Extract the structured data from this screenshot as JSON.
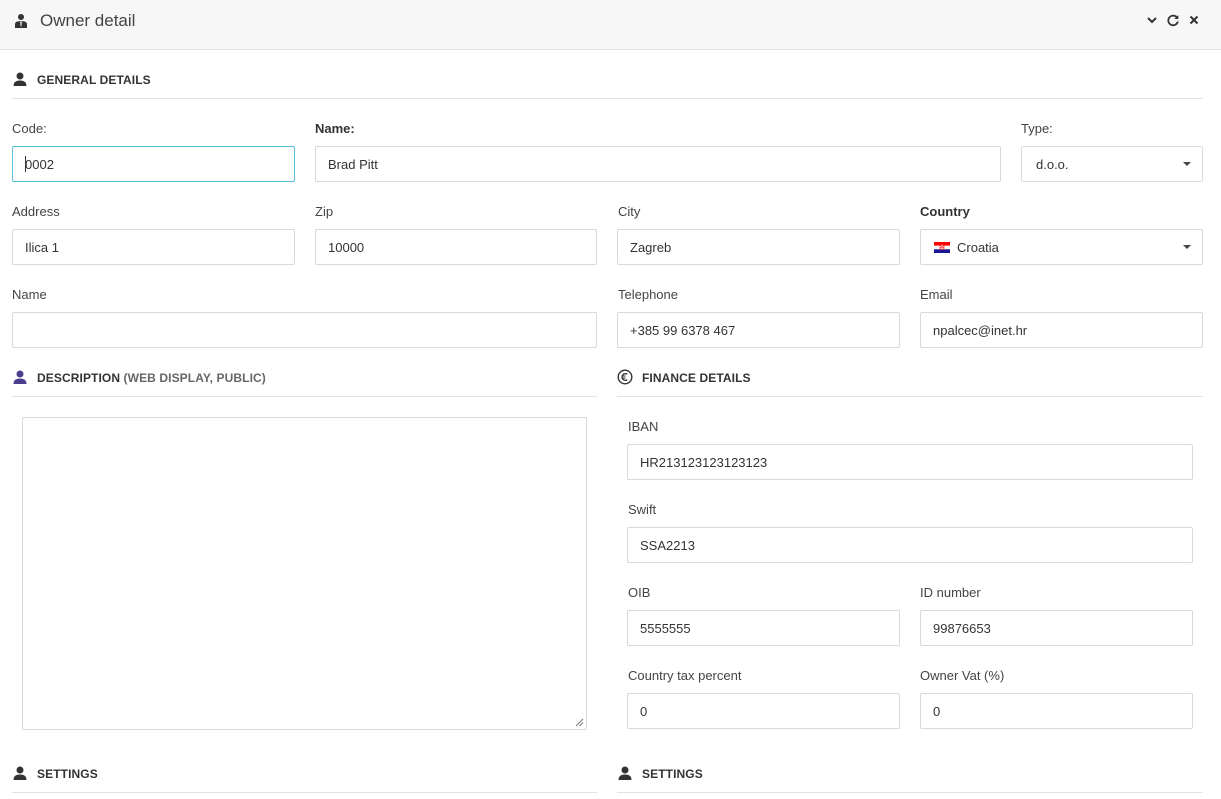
{
  "window": {
    "title": "Owner detail",
    "icons": {
      "title": "owner-icon",
      "collapse": "chevron-down-icon",
      "refresh": "refresh-icon",
      "close": "close-icon"
    }
  },
  "sections": {
    "general": {
      "title": "GENERAL DETAILS",
      "icon": "user-icon"
    },
    "description": {
      "title": "DESCRIPTION",
      "suffix": " (WEB DISPLAY, PUBLIC)",
      "icon": "user-icon"
    },
    "finance": {
      "title": "FINANCE DETAILS",
      "icon": "euro-icon"
    },
    "settings_left": {
      "title": "SETTINGS",
      "icon": "user-icon"
    },
    "settings_right": {
      "title": "SETTINGS",
      "icon": "user-icon"
    }
  },
  "general": {
    "code": {
      "label": "Code:",
      "value": "0002"
    },
    "name": {
      "label": "Name:",
      "value": "Brad Pitt"
    },
    "type": {
      "label": "Type:",
      "value": "d.o.o."
    },
    "address": {
      "label": "Address",
      "value": "Ilica 1"
    },
    "zip": {
      "label": "Zip",
      "value": "10000"
    },
    "city": {
      "label": "City",
      "value": "Zagreb"
    },
    "country": {
      "label": "Country",
      "value": "Croatia",
      "flag_colors": [
        "#ff0000",
        "#ffffff",
        "#171796"
      ]
    },
    "contact_name": {
      "label": "Name",
      "value": ""
    },
    "telephone": {
      "label": "Telephone",
      "value": "+385 99 6378 467"
    },
    "email": {
      "label": "Email",
      "value": "npalcec@inet.hr"
    }
  },
  "description": {
    "value": ""
  },
  "finance": {
    "iban": {
      "label": "IBAN",
      "value": "HR213123123123123"
    },
    "swift": {
      "label": "Swift",
      "value": "SSA2213"
    },
    "oib": {
      "label": "OIB",
      "value": "5555555"
    },
    "id_number": {
      "label": "ID number",
      "value": "99876653"
    },
    "country_tax": {
      "label": "Country tax percent",
      "value": "0"
    },
    "owner_vat": {
      "label": "Owner Vat (%)",
      "value": "0"
    }
  },
  "colors": {
    "focus_border": "#5bc0de",
    "description_icon": "#4a3f8f"
  }
}
